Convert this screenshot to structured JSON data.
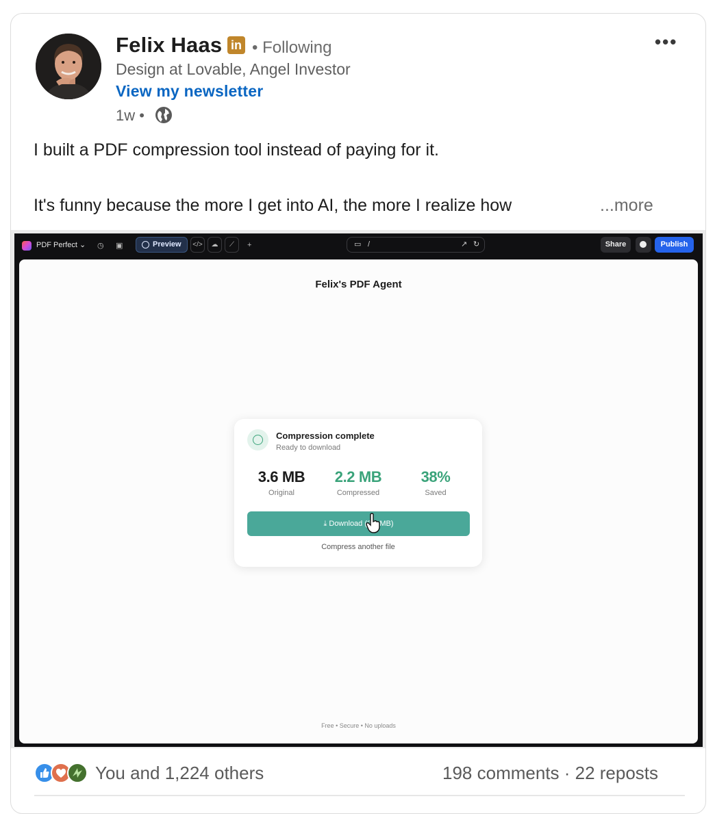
{
  "author": {
    "name": "Felix Haas",
    "badge": "in",
    "follow_status": "• Following",
    "headline": "Design at Lovable, Angel Investor",
    "newsletter_link": "View my newsletter",
    "time": "1w •"
  },
  "post": {
    "line1": "I built a PDF compression tool instead of paying for it.",
    "line2": "It's funny because the more I get into AI, the more I realize how",
    "see_more": "...more"
  },
  "screenshot": {
    "toolbar": {
      "project": "PDF Perfect",
      "preview": "Preview",
      "url": "/",
      "share": "Share",
      "publish": "Publish"
    },
    "page_title": "Felix's PDF Agent",
    "result": {
      "title": "Compression complete",
      "subtitle": "Ready to download",
      "stats": [
        {
          "value": "3.6 MB",
          "label": "Original",
          "color": "#1c1c1c"
        },
        {
          "value": "2.2 MB",
          "label": "Compressed",
          "color": "#3aa37a"
        },
        {
          "value": "38%",
          "label": "Saved",
          "color": "#3aa37a"
        }
      ],
      "download_label": "⤓  Download (2.2 MB)",
      "another": "Compress another file"
    },
    "footer": "Free • Secure • No uploads"
  },
  "social": {
    "reactions_text": "You and 1,224 others",
    "engagement": "198 comments · 22 reposts"
  },
  "colors": {
    "link": "#0a66c2",
    "brand_badge": "#c0862b",
    "accent_green": "#4aa899",
    "publish_blue": "#2563eb"
  }
}
